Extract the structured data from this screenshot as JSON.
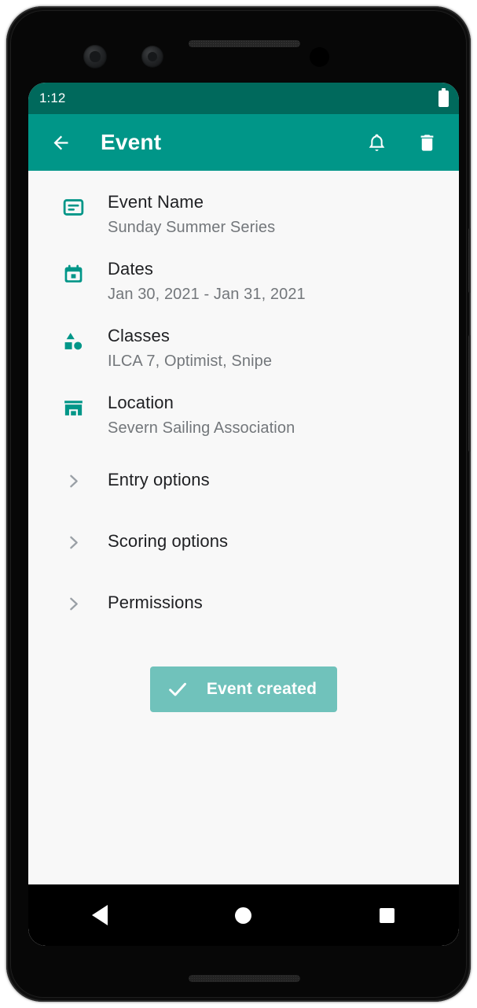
{
  "status_bar": {
    "time": "1:12",
    "battery_icon": "battery-full-icon"
  },
  "app_bar": {
    "back_icon": "arrow-back-icon",
    "title": "Event",
    "notification_icon": "bell-icon",
    "delete_icon": "trash-icon",
    "background_color": "#009688"
  },
  "detail_rows": [
    {
      "icon": "subject-note-icon",
      "label": "Event Name",
      "value": "Sunday Summer Series"
    },
    {
      "icon": "calendar-icon",
      "label": "Dates",
      "value": "Jan 30, 2021 - Jan 31, 2021"
    },
    {
      "icon": "category-shapes-icon",
      "label": "Classes",
      "value": "ILCA 7, Optimist, Snipe"
    },
    {
      "icon": "store-icon",
      "label": "Location",
      "value": "Severn Sailing Association"
    }
  ],
  "nav_rows": [
    {
      "icon": "chevron-right-icon",
      "label": "Entry options"
    },
    {
      "icon": "chevron-right-icon",
      "label": "Scoring options"
    },
    {
      "icon": "chevron-right-icon",
      "label": "Permissions"
    }
  ],
  "snackbar": {
    "icon": "check-icon",
    "text": "Event created",
    "background_color": "rgba(0,150,136,0.55)"
  },
  "android_nav": {
    "back": "triangle-back-icon",
    "home": "circle-home-icon",
    "recents": "square-recents-icon"
  },
  "theme": {
    "primary": "#009688",
    "primary_dark": "#00695c",
    "icon_teal": "#009688",
    "background": "#f8f8f8",
    "text_primary": "#202124",
    "text_secondary": "#73777b"
  }
}
